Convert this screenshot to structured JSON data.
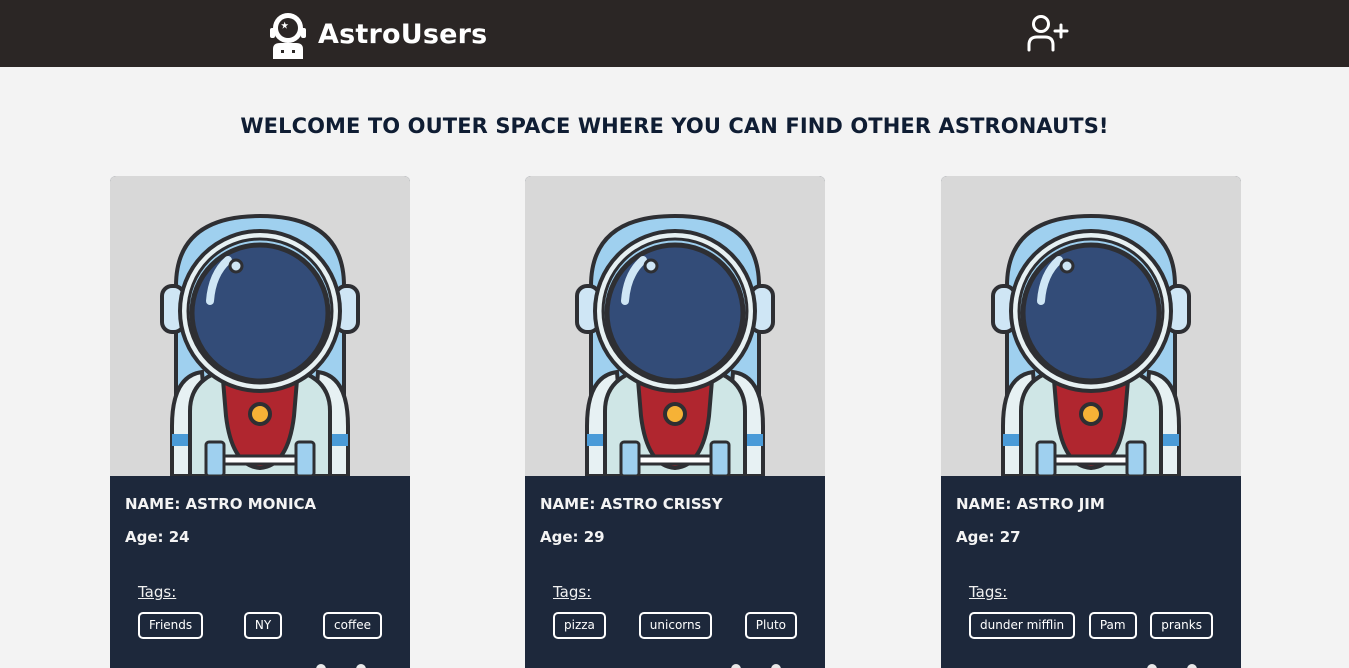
{
  "header": {
    "brand": "AstroUsers",
    "logo_icon": "astronaut-logo-icon",
    "add_user_icon": "add-user-icon"
  },
  "main": {
    "welcome": "WELCOME TO OUTER SPACE WHERE YOU CAN FIND OTHER ASTRONAUTS!"
  },
  "cards": [
    {
      "name": "NAME: ASTRO MONICA",
      "age": "Age: 24",
      "tags_label": "Tags:",
      "tags": [
        "Friends",
        "NY",
        "coffee"
      ]
    },
    {
      "name": "NAME: ASTRO CRISSY",
      "age": "Age: 29",
      "tags_label": "Tags:",
      "tags": [
        "pizza",
        "unicorns",
        "Pluto"
      ]
    },
    {
      "name": "NAME: ASTRO JIM",
      "age": "Age: 27",
      "tags_label": "Tags:",
      "tags": [
        "dunder mifflin",
        "Pam",
        "pranks"
      ]
    }
  ],
  "colors": {
    "header_bg": "#2b2625",
    "page_bg": "#f3f3f3",
    "card_body_bg": "#1d283b",
    "card_image_bg": "#d8d8d8",
    "visor": "#334c78",
    "chest_red": "#b0262f",
    "badge_yellow": "#f6b236"
  }
}
